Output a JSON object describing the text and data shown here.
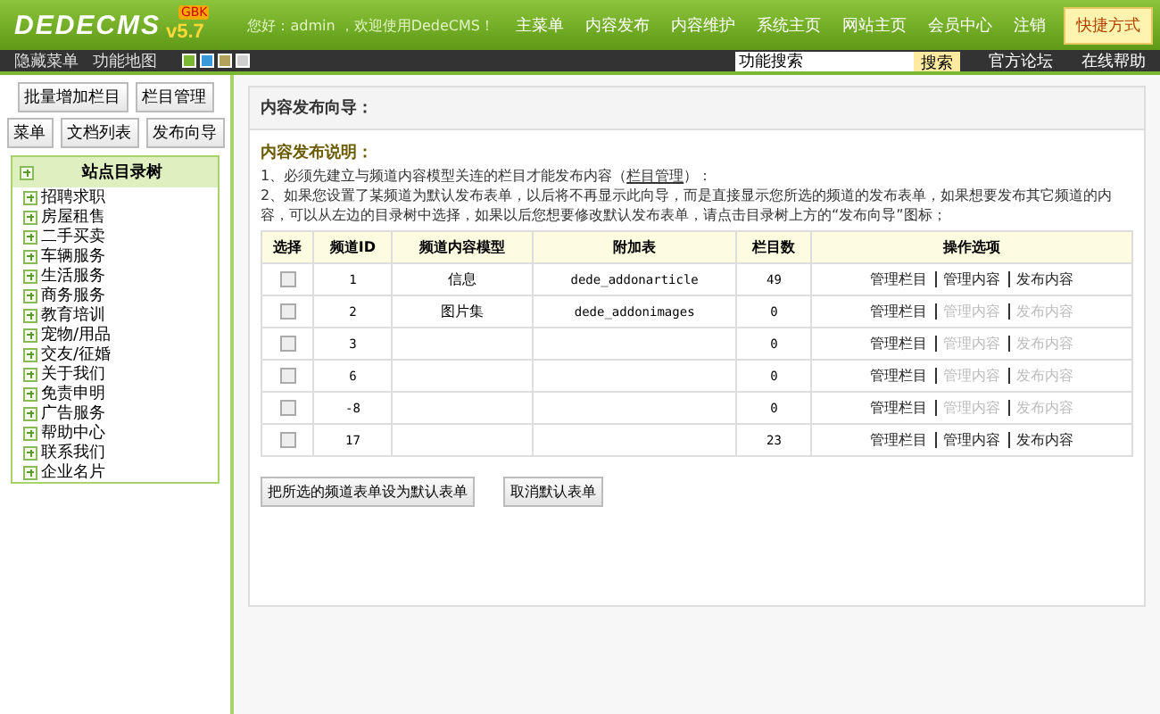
{
  "header": {
    "logo": "DEDECMS",
    "version": "v5.7",
    "edition": "GBK",
    "greeting": "您好：admin ，欢迎使用DedeCMS！",
    "nav": [
      "主菜单",
      "内容发布",
      "内容维护",
      "系统主页",
      "网站主页",
      "会员中心",
      "注销"
    ],
    "shortcut": "快捷方式"
  },
  "toolbar": {
    "items": [
      "隐藏菜单",
      "功能地图"
    ],
    "skins": [
      {
        "color": "#7ab833"
      },
      {
        "color": "#3a9ad9"
      },
      {
        "color": "#b3a25a"
      },
      {
        "color": "#d0d0d0"
      }
    ],
    "search": {
      "value": "功能搜索",
      "button": "搜索"
    },
    "links": [
      "官方论坛",
      "在线帮助"
    ]
  },
  "sidebar": {
    "buttons": [
      [
        "批量增加栏目",
        "栏目管理"
      ],
      [
        "菜单",
        "文档列表",
        "发布向导"
      ]
    ],
    "tree_title": "站点目录树",
    "tree": [
      "招聘求职",
      "房屋租售",
      "二手买卖",
      "车辆服务",
      "生活服务",
      "商务服务",
      "教育培训",
      "宠物/用品",
      "交友/征婚",
      "关于我们",
      "免责申明",
      "广告服务",
      "帮助中心",
      "联系我们",
      "企业名片"
    ]
  },
  "panel": {
    "title": "内容发布向导：",
    "notes_title": "内容发布说明：",
    "note_1": "1、必须先建立与频道内容模型关连的栏目才能发布内容（",
    "note_1_link": "栏目管理",
    "note_1_end": "）：",
    "note_2": "2、如果您设置了某频道为默认发布表单，以后将不再显示此向导，而是直接显示您所选的频道的发布表单，如果想要发布其它频道的内容，可以从左边的目录树中选择，如果以后您想要修改默认发布表单，请点击目录树上方的“发布向导”图标；",
    "table": {
      "columns": [
        "选择",
        "频道ID",
        "频道内容模型",
        "附加表",
        "栏目数",
        "操作选项"
      ],
      "rows": [
        {
          "checked": false,
          "id": "1",
          "model": "信息",
          "table": "dede_addonarticle",
          "count": "49",
          "actions": [
            {
              "label": "管理栏目",
              "disabled": false
            },
            {
              "label": "管理内容",
              "disabled": false
            },
            {
              "label": "发布内容",
              "disabled": false
            }
          ]
        },
        {
          "checked": false,
          "id": "2",
          "model": "图片集",
          "table": "dede_addonimages",
          "count": "0",
          "actions": [
            {
              "label": "管理栏目",
              "disabled": false
            },
            {
              "label": "管理内容",
              "disabled": true
            },
            {
              "label": "发布内容",
              "disabled": true
            }
          ]
        },
        {
          "checked": false,
          "id": "3",
          "count": "0",
          "actions": [
            {
              "label": "管理栏目",
              "disabled": false
            },
            {
              "label": "管理内容",
              "disabled": true
            },
            {
              "label": "发布内容",
              "disabled": true
            }
          ]
        },
        {
          "checked": false,
          "id": "6",
          "count": "0",
          "actions": [
            {
              "label": "管理栏目",
              "disabled": false
            },
            {
              "label": "管理内容",
              "disabled": true
            },
            {
              "label": "发布内容",
              "disabled": true
            }
          ]
        },
        {
          "checked": false,
          "id": "-8",
          "count": "0",
          "actions": [
            {
              "label": "管理栏目",
              "disabled": false
            },
            {
              "label": "管理内容",
              "disabled": true
            },
            {
              "label": "发布内容",
              "disabled": true
            }
          ]
        },
        {
          "checked": false,
          "id": "17",
          "count": "23",
          "actions": [
            {
              "label": "管理栏目",
              "disabled": false
            },
            {
              "label": "管理内容",
              "disabled": false
            },
            {
              "label": "发布内容",
              "disabled": false
            }
          ]
        }
      ]
    },
    "buttons": [
      "把所选的频道表单设为默认表单",
      "取消默认表单"
    ]
  }
}
